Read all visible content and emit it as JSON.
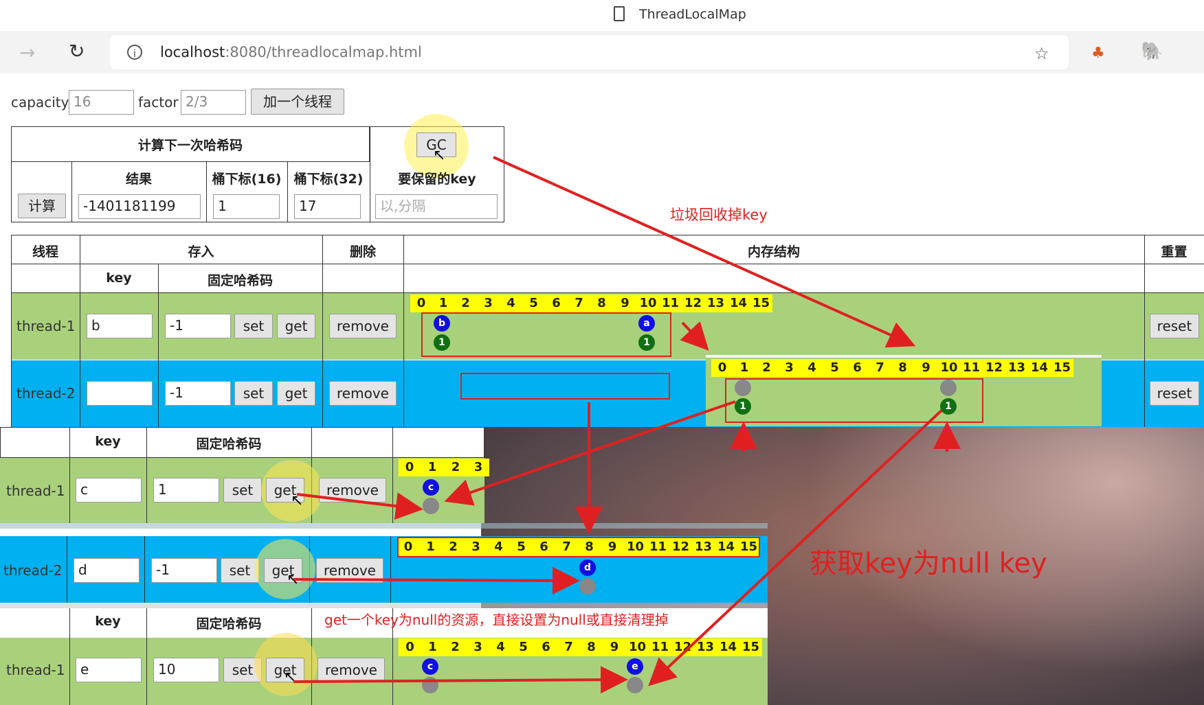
{
  "window": {
    "title": "ThreadLocalMap"
  },
  "address": {
    "host": "localhost",
    "rest": ":8080/threadlocalmap.html"
  },
  "controls": {
    "capacity_label": "capacity",
    "capacity_value": "16",
    "factor_label": "factor",
    "factor_value": "2/3",
    "add_thread": "加一个线程"
  },
  "hash_panel": {
    "title": "计算下一次哈希码",
    "gc_button": "GC",
    "calc_button": "计算",
    "result_header": "结果",
    "bucket16_header": "桶下标(16)",
    "bucket32_header": "桶下标(32)",
    "keep_header": "要保留的key",
    "result_value": "-1401181199",
    "bucket16_value": "1",
    "bucket32_value": "17",
    "keep_placeholder": "以,分隔"
  },
  "main_table": {
    "headers": {
      "thread": "线程",
      "store": "存入",
      "delete": "删除",
      "memory": "内存结构",
      "reset": "重置",
      "key": "key",
      "fixed_hash": "固定哈希码"
    },
    "rows": [
      {
        "name": "thread-1",
        "key": "b",
        "hash": "-1",
        "set": "set",
        "get": "get",
        "remove": "remove",
        "reset": "reset"
      },
      {
        "name": "thread-2",
        "key": "",
        "hash": "-1",
        "set": "set",
        "get": "get",
        "remove": "remove",
        "reset": "reset"
      }
    ],
    "indices16": [
      "0",
      "1",
      "2",
      "3",
      "4",
      "5",
      "6",
      "7",
      "8",
      "9",
      "10",
      "11",
      "12",
      "13",
      "14",
      "15"
    ],
    "thread1_entries": [
      {
        "key": "b",
        "value": "1"
      },
      {
        "key": "a",
        "value": "1"
      }
    ],
    "popup_values": [
      "1",
      "1"
    ]
  },
  "overlay1": {
    "headers": {
      "key": "key",
      "fixed_hash": "固定哈希码"
    },
    "rows": [
      {
        "name": "thread-1",
        "key": "c",
        "hash": "1",
        "set": "set",
        "get": "get",
        "remove": "remove"
      },
      {
        "name": "thread-2",
        "key": "d",
        "hash": "-1",
        "set": "set",
        "get": "get",
        "remove": "remove"
      }
    ],
    "indices4": [
      "0",
      "1",
      "2",
      "3"
    ],
    "dot_c": "c",
    "dot_d": "d"
  },
  "overlay2": {
    "headers": {
      "key": "key",
      "fixed_hash": "固定哈希码"
    },
    "row": {
      "name": "thread-1",
      "key": "e",
      "hash": "10",
      "set": "set",
      "get": "get",
      "remove": "remove"
    },
    "dot_c": "c",
    "dot_e": "e"
  },
  "annotations": {
    "gc_note": "垃圾回收掉key",
    "null_key": "获取key为null key",
    "get_note": "get一个key为null的资源，直接设置为null或直接清理掉"
  }
}
